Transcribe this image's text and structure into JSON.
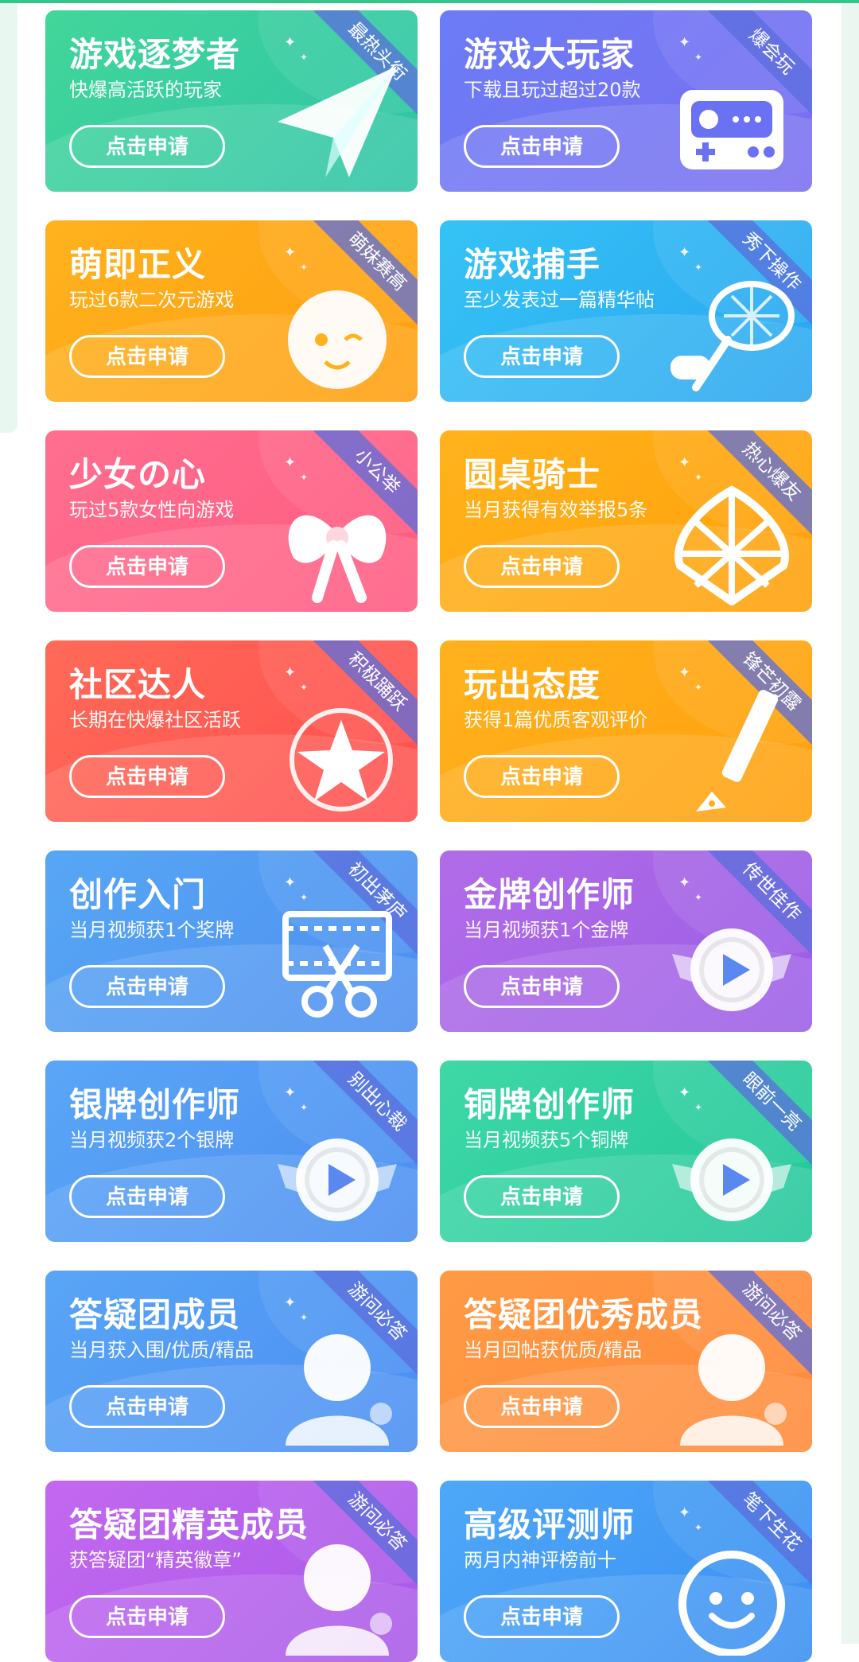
{
  "apply_label": "点击申请",
  "cards": [
    {
      "title": "游戏逐梦者",
      "desc": "快爆高活跃的玩家",
      "tag": "最热头衔",
      "color1": "#42d69a",
      "color2": "#2ec4a6",
      "icon": "paper-plane-icon"
    },
    {
      "title": "游戏大玩家",
      "desc": "下载且玩过超过20款",
      "tag": "爆会玩",
      "color1": "#6b7cf6",
      "color2": "#7b6ff0",
      "icon": "game-console-icon"
    },
    {
      "title": "萌即正义",
      "desc": "玩过6款二次元游戏",
      "tag": "萌妹赛高",
      "color1": "#ffb21e",
      "color2": "#ff9f0f",
      "icon": "anime-girl-icon"
    },
    {
      "title": "游戏捕手",
      "desc": "至少发表过一篇精华帖",
      "tag": "秀下操作",
      "color1": "#35c3f5",
      "color2": "#2aa6f0",
      "icon": "catch-net-icon"
    },
    {
      "title": "少女の心",
      "desc": "玩过5款女性向游戏",
      "tag": "小公举",
      "color1": "#ff6f8f",
      "color2": "#ff5a80",
      "icon": "bow-icon"
    },
    {
      "title": "圆桌骑士",
      "desc": "当月获得有效举报5条",
      "tag": "热心爆友",
      "color1": "#ffb31c",
      "color2": "#ffa00a",
      "icon": "shield-icon"
    },
    {
      "title": "社区达人",
      "desc": "长期在快爆社区活跃",
      "tag": "积极踊跃",
      "color1": "#ff6a57",
      "color2": "#ff4f4f",
      "icon": "star-medal-icon"
    },
    {
      "title": "玩出态度",
      "desc": "获得1篇优质客观评价",
      "tag": "锋芒初露",
      "color1": "#ffb21d",
      "color2": "#ffa00d",
      "icon": "pen-icon"
    },
    {
      "title": "创作入门",
      "desc": "当月视频获1个奖牌",
      "tag": "初出茅庐",
      "color1": "#57a7f5",
      "color2": "#4d8ff0",
      "icon": "film-scissors-icon"
    },
    {
      "title": "金牌创作师",
      "desc": "当月视频获1个金牌",
      "tag": "传世佳作",
      "color1": "#b16ce8",
      "color2": "#9c5ee6",
      "icon": "play-medal-icon"
    },
    {
      "title": "银牌创作师",
      "desc": "当月视频获2个银牌",
      "tag": "别出心裁",
      "color1": "#5aa6f6",
      "color2": "#4b8ef1",
      "icon": "play-medal-icon"
    },
    {
      "title": "铜牌创作师",
      "desc": "当月视频获5个铜牌",
      "tag": "眼前一亮",
      "color1": "#3ed8a6",
      "color2": "#23c79a",
      "icon": "play-medal-icon"
    },
    {
      "title": "答疑团成员",
      "desc": "当月获入围/优质/精品",
      "tag": "游问必答",
      "color1": "#59a5f6",
      "color2": "#4a8ef2",
      "icon": "user-badge-icon"
    },
    {
      "title": "答疑团优秀成员",
      "desc": "当月回帖获优质/精品",
      "tag": "游问必答",
      "color1": "#ff9a45",
      "color2": "#ff8a3a",
      "icon": "user-badge-icon"
    },
    {
      "title": "答疑团精英成员",
      "desc": "获答疑团“精英徽章”",
      "tag": "游问必答",
      "color1": "#c368f0",
      "color2": "#a95ae8",
      "icon": "user-badge-icon"
    },
    {
      "title": "高级评测师",
      "desc": "两月内神评榜前十",
      "tag": "笔下生花",
      "color1": "#4ea8f8",
      "color2": "#3b8ff2",
      "icon": "smiley-icon"
    }
  ]
}
